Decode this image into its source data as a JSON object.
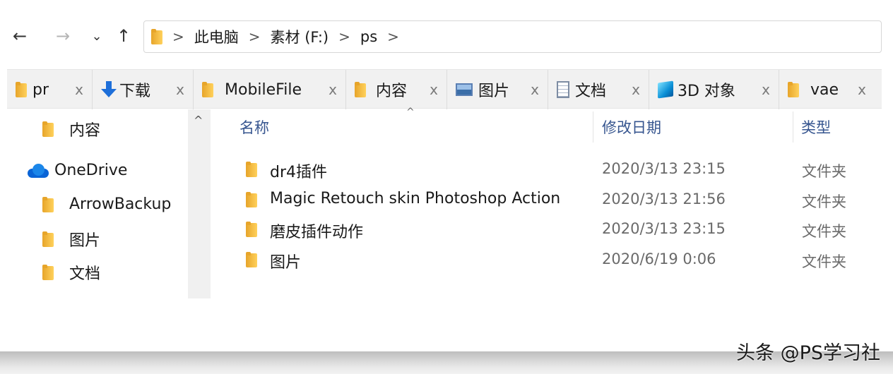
{
  "nav": {
    "back": "←",
    "forward": "→",
    "recent": "⌄",
    "up": "↑"
  },
  "breadcrumb": [
    "此电脑",
    "素材 (F:)",
    "ps"
  ],
  "breadcrumb_sep": ">",
  "tabs": [
    {
      "label": "pr",
      "icon": "folder-icon"
    },
    {
      "label": "下载",
      "icon": "download-icon"
    },
    {
      "label": "MobileFile",
      "icon": "folder-icon"
    },
    {
      "label": "内容",
      "icon": "folder-icon"
    },
    {
      "label": "图片",
      "icon": "pictures-icon"
    },
    {
      "label": "文档",
      "icon": "documents-icon"
    },
    {
      "label": "3D 对象",
      "icon": "3d-objects-icon"
    },
    {
      "label": "vae",
      "icon": "folder-icon"
    }
  ],
  "tab_close": "x",
  "sidebar": {
    "items": [
      {
        "label": "内容",
        "icon": "folder-icon"
      },
      {
        "label": "OneDrive",
        "icon": "onedrive-icon"
      },
      {
        "label": "ArrowBackup",
        "icon": "folder-icon"
      },
      {
        "label": "图片",
        "icon": "folder-icon"
      },
      {
        "label": "文档",
        "icon": "folder-icon"
      }
    ]
  },
  "columns": {
    "name": "名称",
    "date": "修改日期",
    "type": "类型"
  },
  "files": [
    {
      "name": "dr4插件",
      "date": "2020/3/13 23:15",
      "type": "文件夹"
    },
    {
      "name": "Magic Retouch skin Photoshop Action",
      "date": "2020/3/13 21:56",
      "type": "文件夹"
    },
    {
      "name": "磨皮插件动作",
      "date": "2020/3/13 23:15",
      "type": "文件夹"
    },
    {
      "name": "图片",
      "date": "2020/6/19 0:06",
      "type": "文件夹"
    }
  ],
  "watermark": "头条 @PS学习社",
  "colors": {
    "folder": "#ffd15c",
    "header_text": "#36558f",
    "onedrive": "#0a64d6"
  }
}
